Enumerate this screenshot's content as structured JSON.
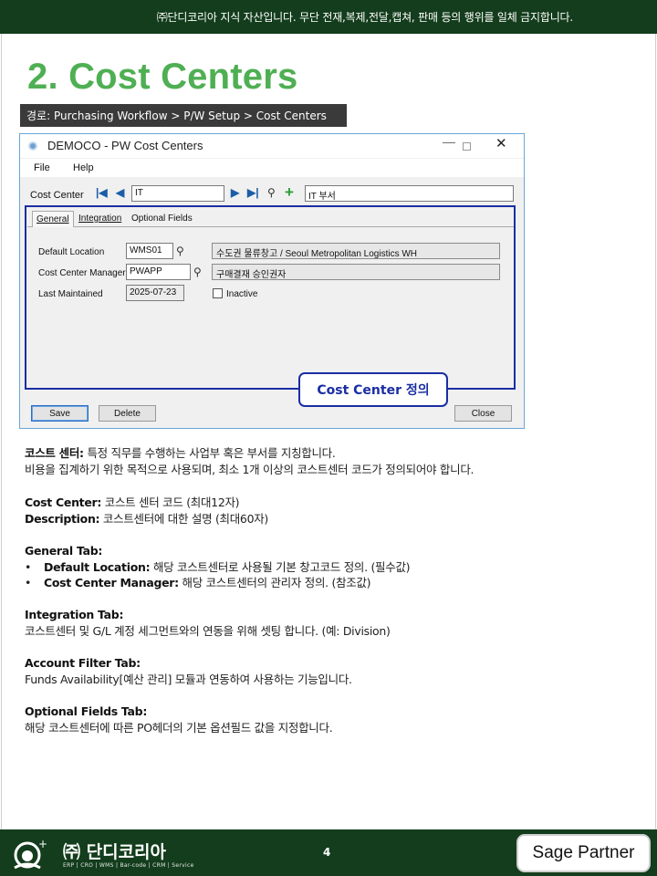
{
  "banner": {
    "text": "㈜단디코리아 지식 자산입니다. 무단 전재,복제,전달,캡쳐, 판매 등의 행위를 일체 금지합니다."
  },
  "page": {
    "title": "2. Cost Centers",
    "path": "경로: Purchasing Workflow > P/W Setup > Cost Centers"
  },
  "window": {
    "title": "DEMOCO - PW Cost Centers",
    "menu": [
      "File",
      "Help"
    ],
    "cost_center_label": "Cost Center",
    "cost_center_value": "IT",
    "description_value": "IT 부서",
    "tabs": [
      "General",
      "Integration",
      "Optional Fields"
    ],
    "fields": {
      "default_location_label": "Default Location",
      "default_location_value": "WMS01",
      "default_location_desc": "수도권 물류창고 / Seoul Metropolitan Logistics WH",
      "manager_label": "Cost Center Manager",
      "manager_value": "PWAPP",
      "manager_desc": "구매결재 승인권자",
      "last_maintained_label": "Last Maintained",
      "last_maintained_value": "2025-07-23",
      "inactive_label": "Inactive"
    },
    "buttons": {
      "save": "Save",
      "delete": "Delete",
      "close": "Close"
    },
    "callout": "Cost Center 정의"
  },
  "content": {
    "intro_bold": "코스트 센터:",
    "intro_text": " 특정 직무를 수행하는 사업부 혹은 부서를 지칭합니다.",
    "intro_line2": "비용을 집계하기 위한 목적으로 사용되며, 최소 1개 이상의 코스트센터 코드가 정의되어야 합니다.",
    "cc_bold": "Cost Center:",
    "cc_text": " 코스트 센터 코드 (최대12자)",
    "desc_bold": "Description:",
    "desc_text": " 코스트센터에 대한 설명 (최대60자)",
    "general_heading": "General Tab:",
    "bullet_marker": "•",
    "general_item1_bold": "Default Location:",
    "general_item1_text": " 해당 코스트센터로 사용될 기본 창고코드 정의. (필수값)",
    "general_item2_bold": "Cost Center Manager:",
    "general_item2_text": " 해당 코스트센터의 관리자 정의. (참조값)",
    "integration_heading": "Integration Tab:",
    "integration_text": "코스트센터 및 G/L 계정 세그먼트와의 연동을 위해 셋팅 합니다. (예: Division)",
    "account_heading": "Account Filter Tab:",
    "account_text": "Funds Availability[예산 관리] 모듈과 연동하여 사용하는 기능입니다.",
    "optional_heading": "Optional Fields Tab:",
    "optional_text": "해당 코스트센터에 따른 PO헤더의 기본 옵션필드 값을 지정합니다."
  },
  "footer": {
    "company": "㈜ 단디코리아",
    "company_sub": "ERP | CRO | WMS | Bar-code | CRM | Service",
    "page_number": "4",
    "partner_badge": "Sage Partner"
  }
}
